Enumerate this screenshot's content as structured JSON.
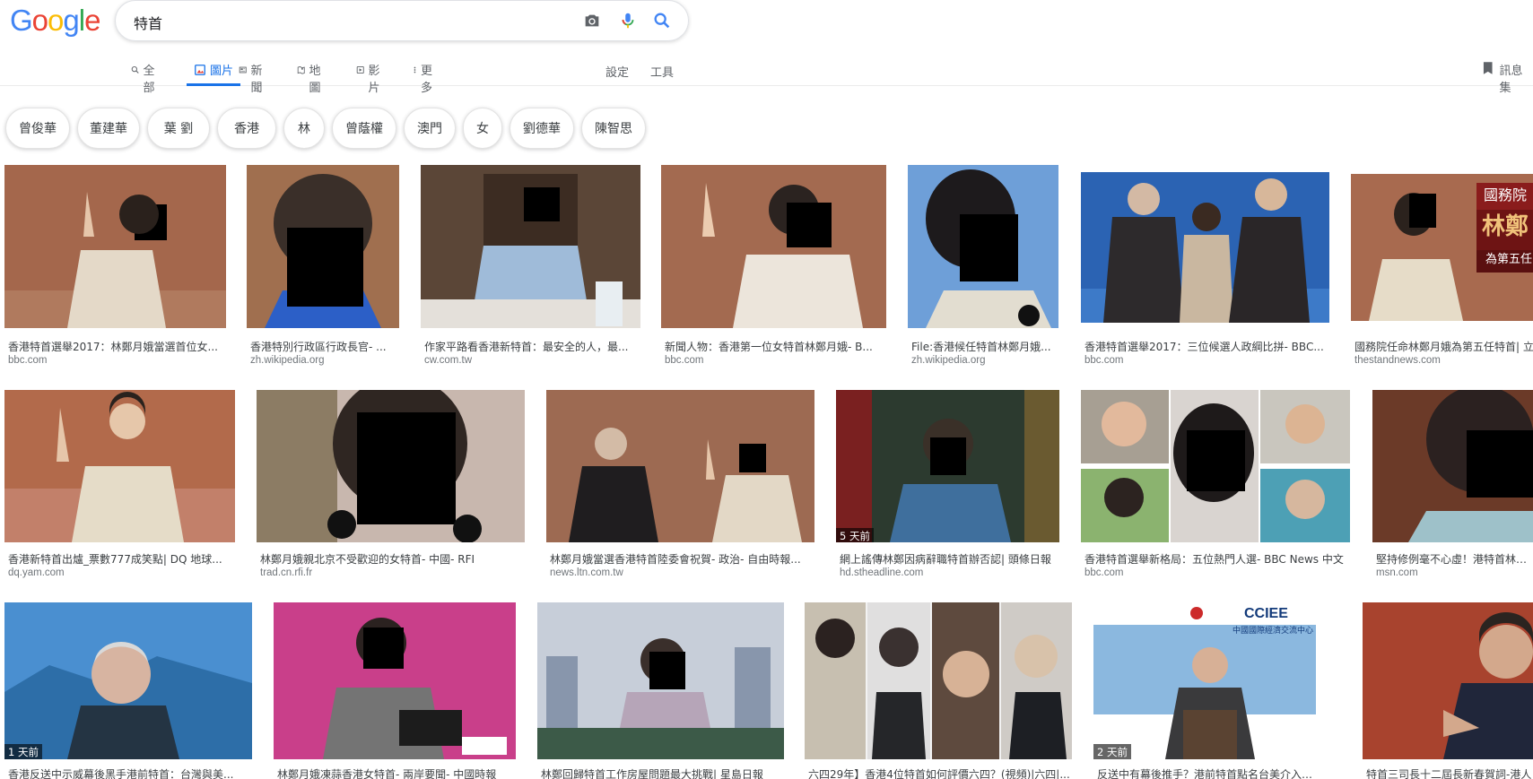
{
  "search": {
    "query": "特首"
  },
  "tabs": [
    {
      "label": "全部",
      "icon": "search-icon"
    },
    {
      "label": "圖片",
      "icon": "image-icon",
      "active": true
    },
    {
      "label": "新聞",
      "icon": "news-icon"
    },
    {
      "label": "地圖",
      "icon": "map-icon"
    },
    {
      "label": "影片",
      "icon": "video-icon"
    },
    {
      "label": "更多",
      "icon": "more-icon"
    }
  ],
  "tools": {
    "settings": "設定",
    "tools": "工具"
  },
  "saved": {
    "label": "訊息集"
  },
  "chips": [
    "曾俊華",
    "董建華",
    "葉 劉",
    "香港",
    "林",
    "曾蔭權",
    "澳門",
    "女",
    "劉德華",
    "陳智思"
  ],
  "results": [
    {
      "caption": "香港特首選舉2017：林鄭月娥當選首位女...",
      "source": "bbc.com",
      "badge": ""
    },
    {
      "caption": "香港特別行政區行政長官- ...",
      "source": "zh.wikipedia.org",
      "badge": ""
    },
    {
      "caption": "作家平路看香港新特首：最安全的人，最...",
      "source": "cw.com.tw",
      "badge": ""
    },
    {
      "caption": "新聞人物：香港第一位女特首林鄭月娥- B...",
      "source": "bbc.com",
      "badge": ""
    },
    {
      "caption": "File:香港候任特首林鄭月娥...",
      "source": "zh.wikipedia.org",
      "badge": ""
    },
    {
      "caption": "香港特首選舉2017：三位候選人政綱比拼- BBC...",
      "source": "bbc.com",
      "badge": ""
    },
    {
      "caption": "國務院任命林鄭月娥為第五任特首| 立",
      "source": "thestandnews.com",
      "badge": ""
    },
    {
      "caption": "香港新特首出爐_票數777成笑點| DQ 地球...",
      "source": "dq.yam.com",
      "badge": ""
    },
    {
      "caption": "林鄭月娥親北京不受歡迎的女特首- 中國- RFI",
      "source": "trad.cn.rfi.fr",
      "badge": ""
    },
    {
      "caption": "林鄭月娥當選香港特首陸委會祝賀- 政治- 自由時報...",
      "source": "news.ltn.com.tw",
      "badge": ""
    },
    {
      "caption": "網上謠傳林鄭因病辭職特首辦否認| 頭條日報",
      "source": "hd.stheadline.com",
      "badge": "5 天前"
    },
    {
      "caption": "香港特首選舉新格局：五位熱門人選- BBC News 中文",
      "source": "bbc.com",
      "badge": ""
    },
    {
      "caption": "堅持修例毫不心虛！港特首林鄭月",
      "source": "msn.com",
      "badge": ""
    },
    {
      "caption": "香港反送中示威幕後黑手港前特首：台灣與美...",
      "source": "",
      "badge": "1 天前"
    },
    {
      "caption": "林鄭月娥凍蒜香港女特首- 兩岸要聞- 中國時報",
      "source": "",
      "badge": ""
    },
    {
      "caption": "林鄭回歸特首工作房屋問題最大挑戰| 星島日報",
      "source": "",
      "badge": ""
    },
    {
      "caption": "六四29年】香港4位特首如何評價六四？(視頻)|六四|...",
      "source": "",
      "badge": ""
    },
    {
      "caption": "反送中有幕後推手？港前特首點名台美介入- 國...",
      "source": "",
      "badge": "2 天前"
    },
    {
      "caption": "特首三司長十二屆長新春賀詞-港人",
      "source": "",
      "badge": ""
    }
  ],
  "overlay_texts": {
    "r7_banner_1": "國務院",
    "r7_banner_2": "林鄭",
    "r7_banner_3": "為第五任",
    "r18_logo": "CCIEE",
    "r18_sub": "中國國際經濟交流中心"
  },
  "colors": {
    "blue": "#4285F4",
    "red": "#EA4335",
    "yellow": "#FBBC05",
    "green": "#34A853",
    "active_tab": "#1a73e8",
    "muted": "#5f6368"
  }
}
